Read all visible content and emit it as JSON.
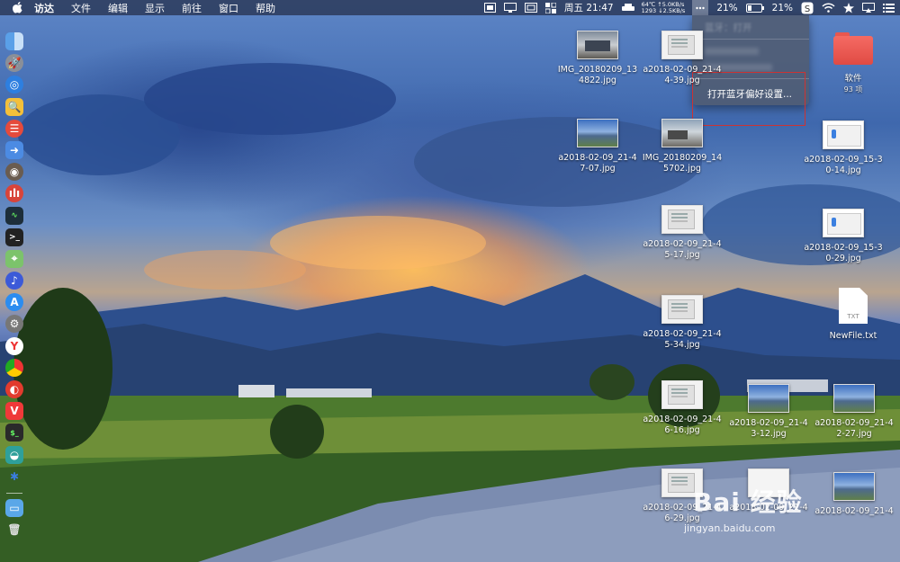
{
  "menubar": {
    "app_menus": [
      "访达",
      "文件",
      "编辑",
      "显示",
      "前往",
      "窗口",
      "帮助"
    ],
    "status": {
      "datetime": "周五 21:47",
      "net_up": "64℃ ↑5.0KB/s",
      "net_down": "1293 ↓2.5KB/s",
      "percent_left": "21%",
      "battery_percent": "21%"
    }
  },
  "bluetooth_menu": {
    "blurred_items": [
      "蓝牙：打开",
      "",
      ""
    ],
    "open_prefs": "打开蓝牙偏好设置..."
  },
  "desktop": {
    "icons": [
      {
        "label": "IMG_20180209_134822.jpg",
        "kind": "photo1"
      },
      {
        "label": "a2018-02-09_21-44-39.jpg",
        "kind": "screenshot"
      },
      {
        "label": "软件",
        "sub": "93 项",
        "kind": "folder"
      },
      {
        "label": "a2018-02-09_21-47-07.jpg",
        "kind": "landscape"
      },
      {
        "label": "IMG_20180209_145702.jpg",
        "kind": "photo2"
      },
      {
        "label": "a2018-02-09_15-30-14.jpg",
        "kind": "bt"
      },
      {
        "label": "a2018-02-09_21-45-17.jpg",
        "kind": "screenshot"
      },
      {
        "label": "a2018-02-09_15-30-29.jpg",
        "kind": "bt"
      },
      {
        "label": "a2018-02-09_21-45-34.jpg",
        "kind": "screenshot"
      },
      {
        "label": "NewFile.txt",
        "kind": "txt",
        "badge": "TXT"
      },
      {
        "label": "a2018-02-09_21-46-16.jpg",
        "kind": "screenshot"
      },
      {
        "label": "a2018-02-09_21-43-12.jpg",
        "kind": "landscape"
      },
      {
        "label": "a2018-02-09_21-42-27.jpg",
        "kind": "landscape"
      },
      {
        "label": "a2018-02-09_21-46-29.jpg",
        "kind": "screenshot"
      },
      {
        "label": "a2018-02-09_21-4",
        "kind": "paw"
      },
      {
        "label": "a2018-02-09_21-4",
        "kind": "landscape"
      }
    ]
  },
  "watermark": {
    "brand": "Bai 经验",
    "url": "jingyan.baidu.com"
  },
  "dock_apps": [
    "finder",
    "launchpad",
    "safari",
    "preview",
    "calendar",
    "migration",
    "camera",
    "istat",
    "activity",
    "terminal",
    "maps",
    "siri",
    "app-store",
    "system-prefs",
    "yandex",
    "chrome",
    "netease",
    "vivaldi",
    "terminal2",
    "vpn",
    "bluetooth",
    "downloads",
    "trash"
  ],
  "colors": {
    "menubar": "#232d46",
    "highlight_box": "#cc3333",
    "folder": "#e8574f"
  }
}
